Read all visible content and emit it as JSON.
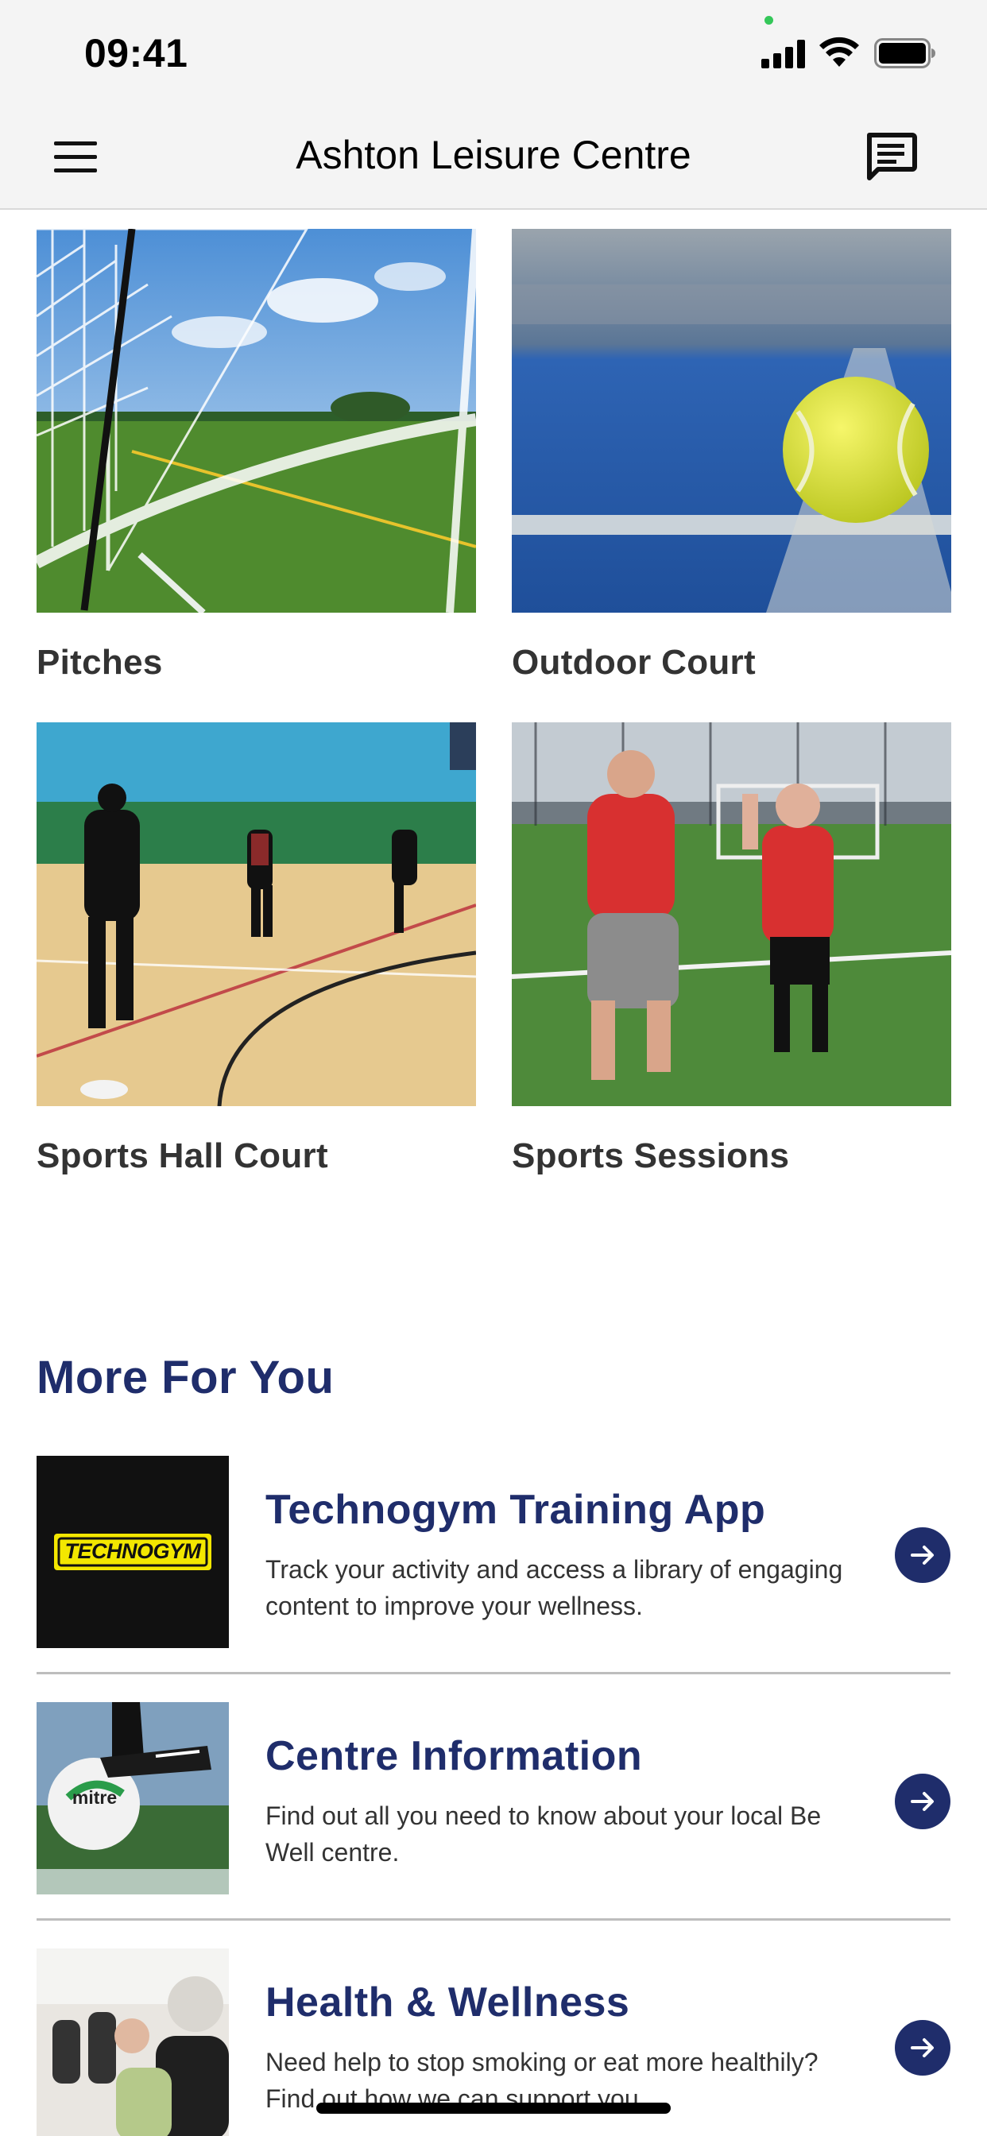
{
  "status_bar": {
    "time": "09:41"
  },
  "nav": {
    "title": "Ashton Leisure Centre"
  },
  "tiles": [
    {
      "label": "Pitches"
    },
    {
      "label": "Outdoor Court"
    },
    {
      "label": "Sports Hall Court"
    },
    {
      "label": "Sports Sessions"
    }
  ],
  "more_section": {
    "title": "More For You",
    "items": [
      {
        "title": "Technogym Training App",
        "description": "Track your activity and access a library of engaging content to improve your wellness.",
        "logo_text": "TECHNOGYM"
      },
      {
        "title": "Centre Information",
        "description": "Find out all you need to know about your local Be Well centre.",
        "ball_text": "mitre"
      },
      {
        "title": "Health & Wellness",
        "description": "Need help to stop smoking or eat more healthily? Find out how we can support you."
      }
    ]
  },
  "colors": {
    "brand_navy": "#1f2d6b",
    "tile_label": "#333333",
    "bar_bg": "#f4f4f4"
  }
}
